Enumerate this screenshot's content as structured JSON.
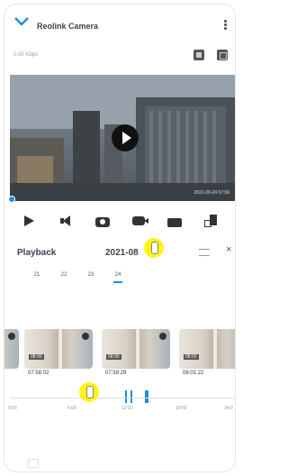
{
  "header": {
    "title": "Reolink Camera",
    "bitrate": "0.00 Kbps"
  },
  "video": {
    "timestamp": "2021-08-24 07:58"
  },
  "controls": [
    {
      "icon": "play-icon"
    },
    {
      "icon": "speaker-icon"
    },
    {
      "icon": "camera-icon"
    },
    {
      "icon": "record-icon"
    },
    {
      "icon": "download-icon"
    },
    {
      "icon": "scale-icon"
    }
  ],
  "playback": {
    "title": "Playback",
    "date": "2021-08",
    "days": [
      "21",
      "22",
      "23",
      "24"
    ],
    "active_day": "24"
  },
  "clips": [
    {
      "badge": "08:00",
      "time": "07:58:02"
    },
    {
      "badge": "08:00",
      "time": "07:59:29"
    },
    {
      "badge": "08:00",
      "time": "08:01:22"
    }
  ],
  "timeline": {
    "labels": [
      "0:00",
      "6:00",
      "12:00",
      "18:00",
      "24:0"
    ]
  }
}
